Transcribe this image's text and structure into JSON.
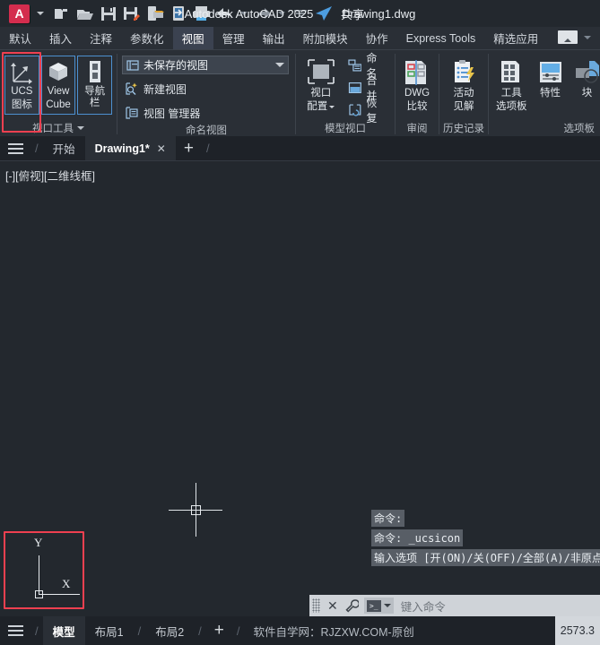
{
  "titlebar": {
    "app_logo_letter": "A",
    "quick_access": [
      {
        "name": "new-drawing-icon",
        "label": "新建"
      },
      {
        "name": "open-drawing-icon",
        "label": "打开"
      },
      {
        "name": "save-icon",
        "label": "保存"
      },
      {
        "name": "save-as-icon",
        "label": "另存为"
      },
      {
        "name": "open-from-web-icon",
        "label": "从 Web 和 Mobile 中打开"
      },
      {
        "name": "save-to-web-icon",
        "label": "保存到 Web 和 Mobile"
      },
      {
        "name": "plot-icon",
        "label": "打印"
      },
      {
        "name": "undo-icon",
        "label": "放弃"
      },
      {
        "name": "redo-icon",
        "label": "重做"
      }
    ],
    "share_label": "共享",
    "product_name": "Autodesk AutoCAD 2025",
    "document_name": "Drawing1.dwg"
  },
  "ribbon_tabs": [
    {
      "label": "默认",
      "active": false
    },
    {
      "label": "插入",
      "active": false
    },
    {
      "label": "注释",
      "active": false
    },
    {
      "label": "参数化",
      "active": false
    },
    {
      "label": "视图",
      "active": true
    },
    {
      "label": "管理",
      "active": false
    },
    {
      "label": "输出",
      "active": false
    },
    {
      "label": "附加模块",
      "active": false
    },
    {
      "label": "协作",
      "active": false
    },
    {
      "label": "Express Tools",
      "active": false
    },
    {
      "label": "精选应用",
      "active": false
    }
  ],
  "ribbon_panels": {
    "viewport_tools": {
      "title": "视口工具",
      "ucs_icon_btn": {
        "line1": "UCS",
        "line2": "图标",
        "highlighted": true
      },
      "viewcube_btn": {
        "line1": "View",
        "line2": "Cube"
      },
      "navbar_btn": {
        "line1": "导航栏",
        "line2": ""
      }
    },
    "named_views": {
      "title": "命名视图",
      "view_combo_value": "未保存的视图",
      "new_view_label": "新建视图",
      "view_manager_label": "视图 管理器"
    },
    "model_viewports": {
      "title": "模型视口",
      "config_btn": {
        "line1": "视口",
        "line2": "配置"
      },
      "named_label": "命名",
      "join_label": "合并",
      "restore_label": "恢复"
    },
    "review": {
      "title": "审阅",
      "dwg_compare_btn": {
        "line1": "DWG",
        "line2": "比较"
      }
    },
    "history": {
      "title": "历史记录",
      "activity_insights_btn": {
        "line1": "活动",
        "line2": "见解"
      }
    },
    "palettes": {
      "title": "选项板",
      "tool_palettes_btn": {
        "line1": "工具",
        "line2": "选项板"
      },
      "properties_btn": {
        "line1": "特性",
        "line2": ""
      },
      "blocks_btn": {
        "line1": "块",
        "line2": ""
      }
    }
  },
  "file_tabs": {
    "start_tab": "开始",
    "drawing_tab": "Drawing1*",
    "close_glyph": "✕",
    "new_tab_glyph": "+"
  },
  "canvas": {
    "viewport_label": "[-][俯视][二维线框]",
    "ucs_x_label": "X",
    "ucs_y_label": "Y"
  },
  "command_history": [
    "命令:",
    "命令: _ucsicon",
    "输入选项 [开(ON)/关(OFF)/全部(A)/非原点"
  ],
  "command_bar": {
    "placeholder": "键入命令",
    "close_glyph": "✕"
  },
  "statusbar": {
    "model_tab": "模型",
    "layout1_tab": "布局1",
    "layout2_tab": "布局2",
    "add_layout_glyph": "+",
    "watermark": "软件自学网：RJZXW.COM-原创",
    "coordinates": "2573.3"
  },
  "colors": {
    "accent_red": "#ef4050",
    "highlight_blue": "#4d90d0",
    "canvas_bg": "#23282e",
    "ribbon_bg": "#2a2f36"
  }
}
